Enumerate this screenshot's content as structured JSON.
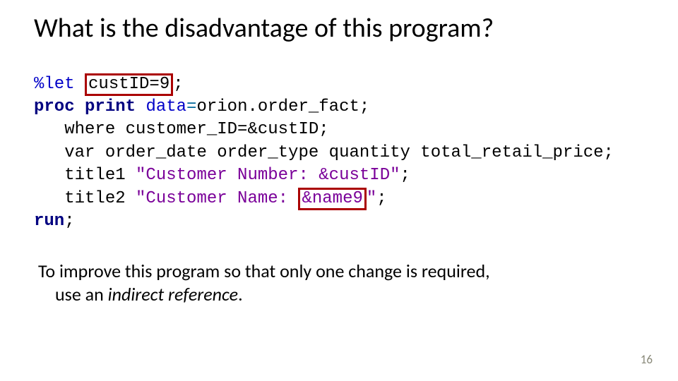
{
  "title": "What is the disadvantage of this program?",
  "code": {
    "l1_pct": "%let",
    "l1_box": "custID=9",
    "l1_tail": ";",
    "l2_proc": "proc",
    "l2_print": "print",
    "l2_data": "data",
    "l2_eq": "=",
    "l2_rest": "orion.order_fact;",
    "l3": "   where customer_ID=&custID;",
    "l4": "   var order_date order_type quantity total_retail_price;",
    "l5a": "   title1 ",
    "l5b": "\"Customer Number: &custID\"",
    "l5c": ";",
    "l6a": "   title2 ",
    "l6b": "\"Customer Name: ",
    "l6box": "&name9",
    "l6c": "\"",
    "l6d": ";",
    "l7": "run",
    "l7b": ";"
  },
  "body": {
    "line1": "To improve this program so that only one change is required,",
    "line2a": "use an ",
    "line2b": "indirect reference",
    "line2c": "."
  },
  "pagenum": "16"
}
